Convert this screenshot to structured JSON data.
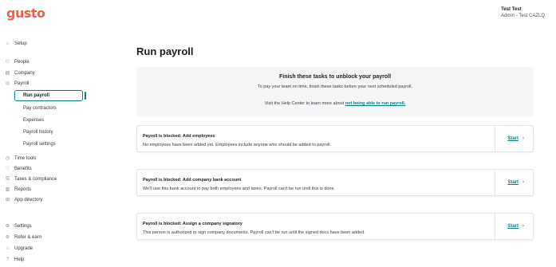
{
  "app": {
    "logo": "gusto"
  },
  "user": {
    "name": "Test Test",
    "role": "Admin - Test CAZLQ"
  },
  "sidebar": {
    "items": [
      {
        "label": "Setup",
        "icon": "⌂",
        "icon_name": "home-icon"
      },
      {
        "label": "People",
        "icon": "⚇",
        "icon_name": "people-icon"
      },
      {
        "label": "Company",
        "icon": "▤",
        "icon_name": "building-icon"
      },
      {
        "label": "Payroll",
        "icon": "◎",
        "icon_name": "payroll-icon"
      },
      {
        "label": "Time tools",
        "icon": "◷",
        "icon_name": "clock-icon"
      },
      {
        "label": "Benefits",
        "icon": "♡",
        "icon_name": "heart-icon"
      },
      {
        "label": "Taxes & compliance",
        "icon": "☰",
        "icon_name": "taxes-icon"
      },
      {
        "label": "Reports",
        "icon": "▥",
        "icon_name": "reports-icon"
      },
      {
        "label": "App directory",
        "icon": "⊞",
        "icon_name": "apps-icon"
      },
      {
        "label": "Settings",
        "icon": "⚙",
        "icon_name": "gear-icon"
      },
      {
        "label": "Refer & earn",
        "icon": "⊛",
        "icon_name": "gift-icon"
      },
      {
        "label": "Upgrade",
        "icon": "☆",
        "icon_name": "star-icon"
      },
      {
        "label": "Help",
        "icon": "?",
        "icon_name": "help-icon"
      }
    ],
    "payroll_sub": [
      "Run payroll",
      "Pay contractors",
      "Expenses",
      "Payroll history",
      "Payroll settings"
    ]
  },
  "main": {
    "title": "Run payroll",
    "banner": {
      "title": "Finish these tasks to unblock your payroll",
      "subtitle": "To pay your team on time, finish these tasks before your next scheduled payroll.",
      "help_prefix": "Visit the Help Center to learn more about ",
      "help_link": "not being able to run payroll."
    },
    "tasks": [
      {
        "title": "Payroll is blocked: Add employees",
        "description": "No employees have been added yet. Employees include anyone who should be added to payroll.",
        "action": "Start"
      },
      {
        "title": "Payroll is blocked: Add company bank account",
        "description": "We'll use this bank account to pay both employees and taxes. Payroll can't be run until this is done.",
        "action": "Start"
      },
      {
        "title": "Payroll is blocked: Assign a company signatory",
        "description": "This person is authorized to sign company documents. Payroll can't be run until the signed docs have been added.",
        "action": "Start"
      }
    ],
    "chevron": "›"
  },
  "colors": {
    "brand": "#f45d48",
    "accent": "#0a8080"
  }
}
